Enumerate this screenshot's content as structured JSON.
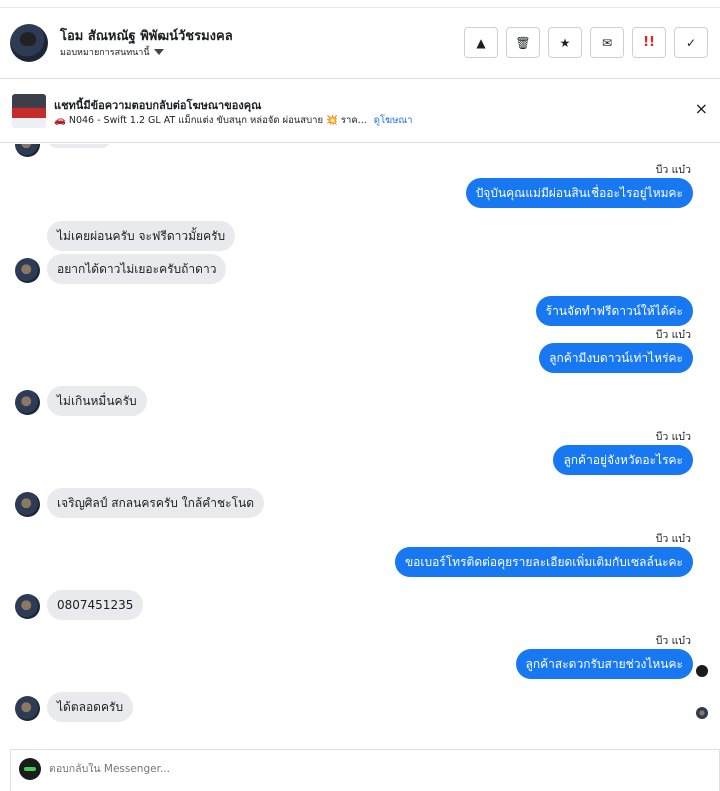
{
  "header": {
    "contact_name": "โอม สัณหณัฐ พิพัฒน์วัชรมงคล",
    "assign_label": "มอบหมายการสนทนานี้",
    "actions": [
      {
        "name": "report-button",
        "glyph": "▲"
      },
      {
        "name": "delete-button",
        "glyph": "🗑"
      },
      {
        "name": "star-button",
        "glyph": "★"
      },
      {
        "name": "mark-unread-button",
        "glyph": "✉"
      },
      {
        "name": "spam-button",
        "glyph": "!!"
      },
      {
        "name": "done-button",
        "glyph": "✓"
      }
    ]
  },
  "ad_banner": {
    "title": "แชทนี้มีข้อความตอบกลับต่อโฆษณาของคุณ",
    "subtitle": "🚗 N046 - Swift 1.2 GL AT แม็กแต่ง ขับสนุก หล่อจัด ผ่อนสบาย 💥 ราค...",
    "link": "ดูโฆษณา",
    "close_glyph": "×"
  },
  "messages": {
    "seen_label": "บีว แบ๋ว",
    "out_1": "ปัจุบันคุณแม่มีผ่อนสินเชื่ออะไรอยู่ไหมคะ",
    "in_1": "ไม่เคยผ่อนครับ จะฟรีดาวมั้ยครับ",
    "in_2": "อยากได้ดาวไม่เยอะครับถ้าดาว",
    "out_2": "ร้านจัดทำฟรีดาวน์ให้ได้ค่ะ",
    "out_3": "ลูกค้ามีงบดาวน์เท่าไหร่คะ",
    "in_3": "ไม่เกินหมื่นครับ",
    "out_4": "ลูกค้าอยู่จังหวัดอะไรคะ",
    "in_4": "เจริญศิลป์ สกลนครครับ ใกล้คำชะโนด",
    "out_5": "ขอเบอร์โทรติดต่อคุยรายละเอียดเพิ่มเติมกับเซลล์นะคะ",
    "in_5": "0807451235",
    "out_6": "ลูกค้าสะดวกรับสายช่วงไหนคะ",
    "in_6": "ได้ตลอดครับ"
  },
  "reply": {
    "placeholder": "ตอบกลับใน Messenger..."
  }
}
